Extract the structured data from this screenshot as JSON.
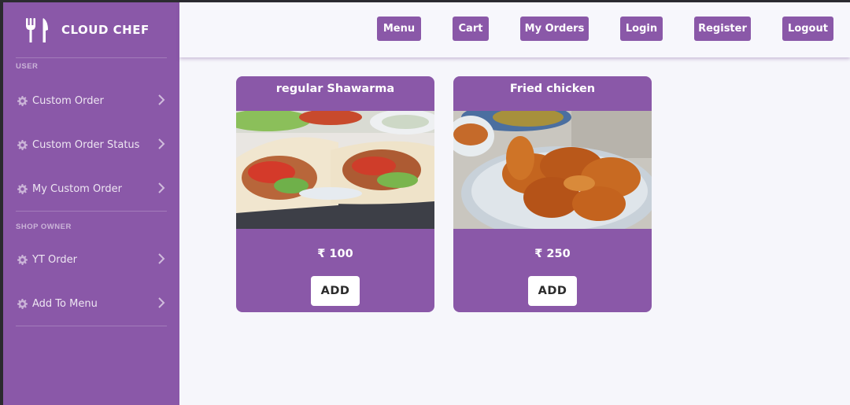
{
  "brand": {
    "name": "CLOUD CHEF",
    "icon": "fork-knife-icon"
  },
  "sidebar": {
    "sections": [
      {
        "label": "USER",
        "items": [
          {
            "label": "Custom Order",
            "icon": "gear-icon"
          },
          {
            "label": "Custom Order Status",
            "icon": "gear-icon"
          },
          {
            "label": "My Custom Order",
            "icon": "gear-icon"
          }
        ]
      },
      {
        "label": "SHOP OWNER",
        "items": [
          {
            "label": "YT Order",
            "icon": "gear-icon"
          },
          {
            "label": "Add To Menu",
            "icon": "gear-icon"
          }
        ]
      }
    ]
  },
  "topnav": {
    "menu": "Menu",
    "cart": "Cart",
    "my_orders": "My Orders",
    "login": "Login",
    "register": "Register",
    "logout": "Logout"
  },
  "products": [
    {
      "name": "regular Shawarma",
      "price": "₹ 100",
      "add_label": "ADD",
      "image": "shawarma-photo"
    },
    {
      "name": "Fried chicken",
      "price": "₹ 250",
      "add_label": "ADD",
      "image": "fried-chicken-photo"
    }
  ],
  "colors": {
    "accent": "#8a58a8",
    "background": "#f6f6fb"
  }
}
